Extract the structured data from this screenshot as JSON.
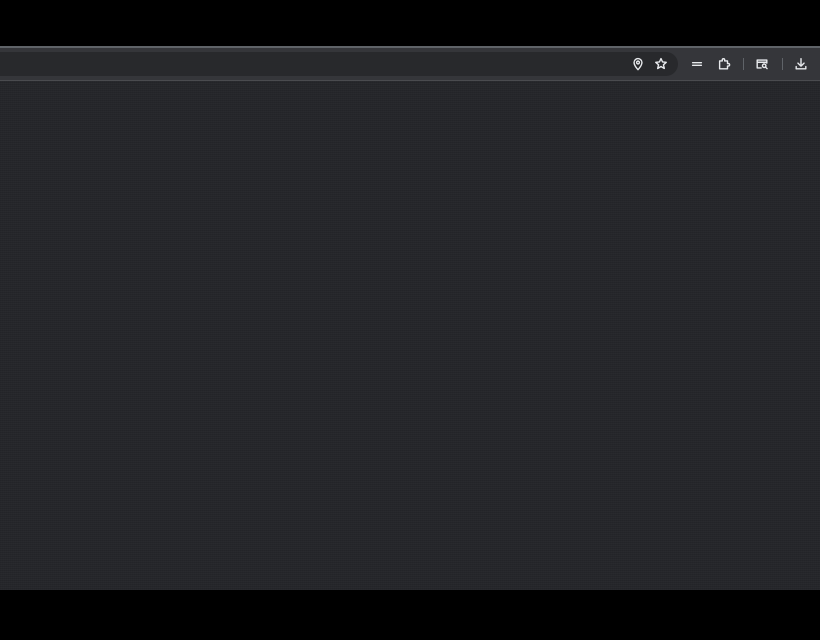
{
  "toolbar": {
    "icons": [
      "location-pin-icon",
      "bookmark-star-icon",
      "tab-search-icon",
      "extensions-icon",
      "side-panel-icon",
      "download-icon"
    ]
  },
  "colors": {
    "window_background": "#202124",
    "toolbar_background": "#35363a",
    "omnibox_background": "#28292c",
    "content_background": "#25262a",
    "icon_color": "#e8eaed"
  }
}
